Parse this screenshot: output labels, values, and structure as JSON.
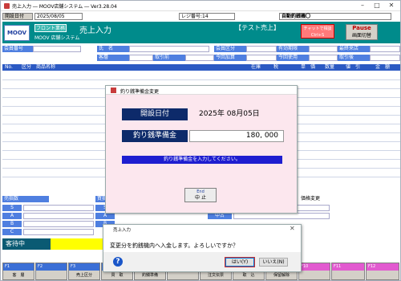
{
  "window": {
    "title": "売上入力 ― MOOV店舗システム ― Ver3.28.04"
  },
  "infobar": {
    "open_date_label": "開設日付",
    "open_date": "2025/08/05",
    "register_label": "レジ番号:14",
    "auto_drawer_label": "自動釣銭機〇"
  },
  "header": {
    "category": "フロント業務",
    "title": "売上入力",
    "system": "MOOV 店舗システム",
    "mode": "【テスト売上】",
    "logo": "MOOV",
    "chat_label": "チャットで相談",
    "chat_key": "Ctrl+S",
    "pause_top": "Pause",
    "pause_bottom": "画面切替"
  },
  "customer": {
    "member_no": "会員番号",
    "name": "氏　名",
    "member_cat": "会員区分",
    "valid_until": "有効期限",
    "last_visit": "最終来店",
    "customer": "客層",
    "discount_before": "取引前",
    "points_now": "今回加算",
    "points_use": "今回使用",
    "discount_after": "取引後"
  },
  "grid": {
    "columns": [
      "No.",
      "区分",
      "商品名称",
      "在庫",
      "税",
      "単　価",
      "数量",
      "値　引",
      "金　額"
    ]
  },
  "bottom": {
    "pointer_header": "売指数",
    "buy_header": "買指数",
    "labels_left": [
      "S",
      "A",
      "B",
      "C"
    ],
    "labels_mid": [
      "S",
      "A",
      "B"
    ],
    "right_labels": [
      "新品",
      "中古"
    ],
    "price_change": "価格変更",
    "waiting": "客待中"
  },
  "fkeys": [
    {
      "n": "F1",
      "l": "客　層"
    },
    {
      "n": "F2",
      "l": ""
    },
    {
      "n": "F3",
      "l": "売上区分"
    },
    {
      "n": "F4",
      "l": "買　取"
    },
    {
      "n": "F5",
      "l": "釣銭準備"
    },
    {
      "n": "F6",
      "l": ""
    },
    {
      "n": "F7",
      "l": "注文伝票"
    },
    {
      "n": "F8",
      "l": "取　込"
    },
    {
      "n": "F9",
      "l": "保留解除"
    },
    {
      "n": "F10",
      "l": ""
    },
    {
      "n": "F11",
      "l": ""
    },
    {
      "n": "F12",
      "l": ""
    }
  ],
  "dialog1": {
    "title": "釣り銭準備金変更",
    "date_label": "開設日付",
    "date_value": "2025年 08月05日",
    "amount_label": "釣り銭準備金",
    "amount_value": "180, 000",
    "message": "釣り銭準備金を入力してください。",
    "end_key": "End",
    "end_label": "中 止"
  },
  "dialog2": {
    "title": "売上入力",
    "message": "変更分を釣銭機内へ入金します。よろしいですか？",
    "yes": "はい(Y)",
    "no": "いいえ(N)"
  }
}
